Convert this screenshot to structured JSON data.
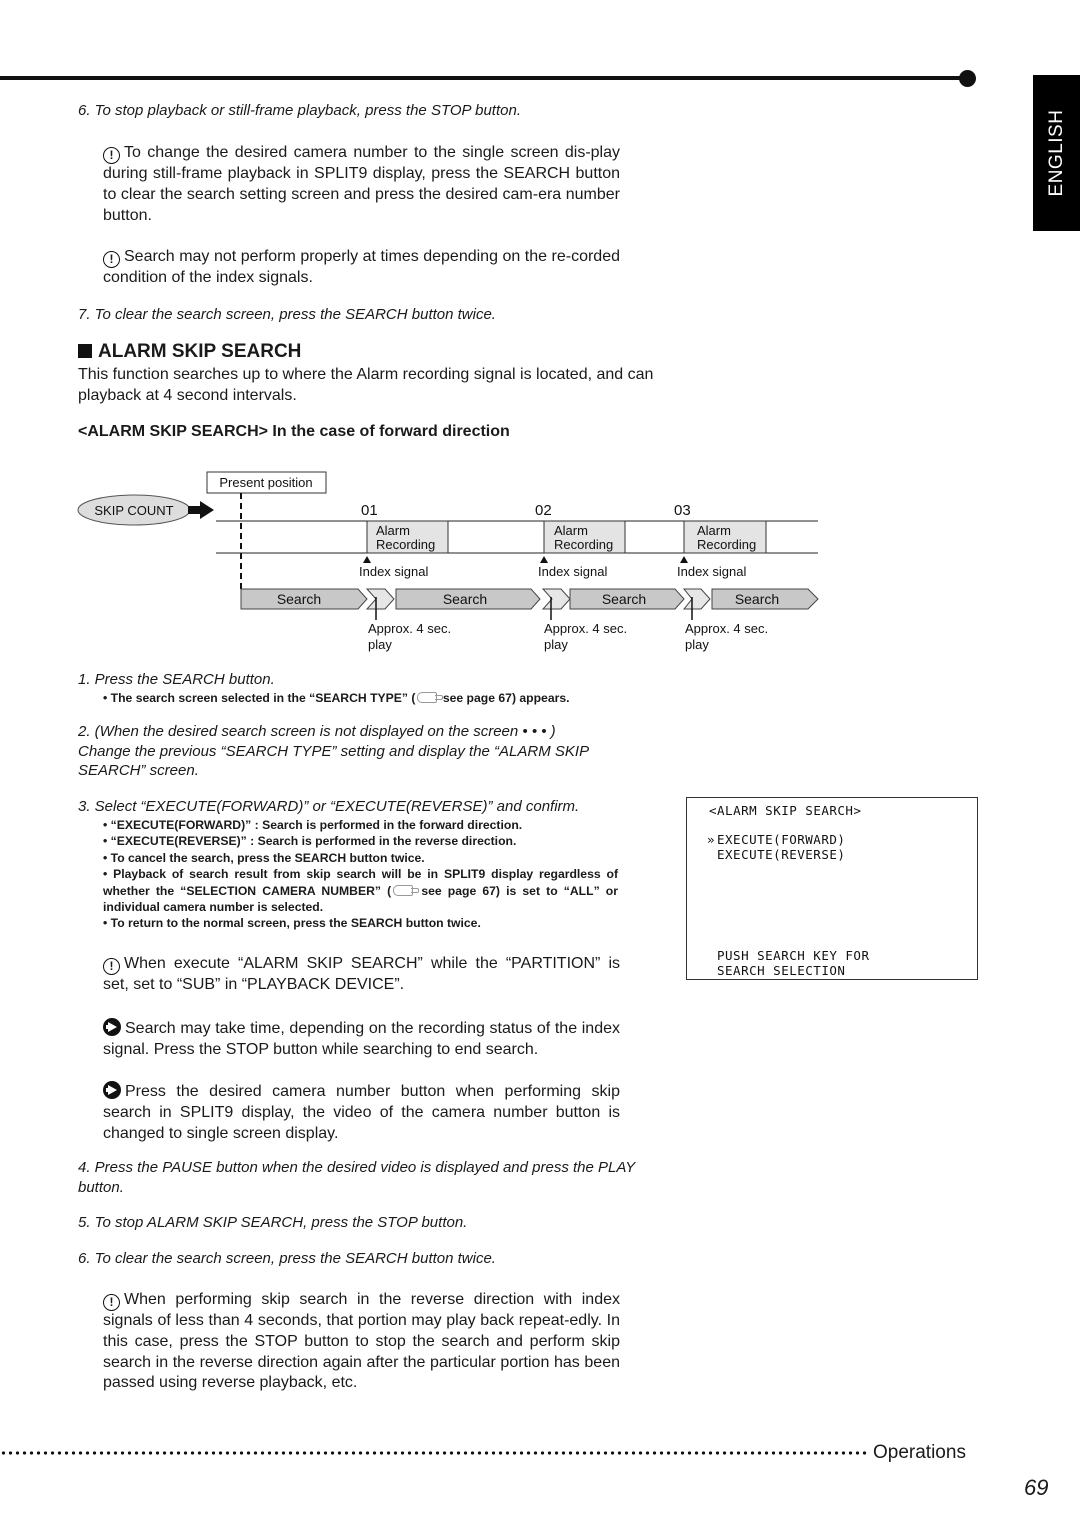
{
  "sidebar_tab": {
    "label": "ENGLISH"
  },
  "top_steps": [
    {
      "text": "6. To stop playback or still-frame playback, press the STOP button."
    },
    {
      "text": "7. To clear the search screen, press the SEARCH button twice."
    }
  ],
  "top_notes": [
    {
      "icon": "caution-icon",
      "text": "To change the desired camera number to the single screen dis-play during still-frame playback in SPLIT9 display, press the SEARCH button to clear the search setting screen and press the desired cam-era number button."
    },
    {
      "icon": "caution-icon",
      "text": "Search may not perform properly at times depending on the re-corded condition of the index signals."
    }
  ],
  "section": {
    "title": "ALARM SKIP SEARCH",
    "intro": "This function searches up to where the Alarm recording signal is located, and can playback at 4 second intervals.",
    "subheading": "<ALARM SKIP SEARCH> In the case of forward direction"
  },
  "diagram": {
    "present_position": "Present position",
    "skip_count": "SKIP COUNT",
    "markers": [
      {
        "count": "01",
        "block_line1": "Alarm",
        "block_line2": "Recording",
        "index_label": "Index signal",
        "play_line1": "Approx. 4 sec.",
        "play_line2": "play"
      },
      {
        "count": "02",
        "block_line1": "Alarm",
        "block_line2": "Recording",
        "index_label": "Index signal",
        "play_line1": "Approx. 4 sec.",
        "play_line2": "play"
      },
      {
        "count": "03",
        "block_line1": "Alarm",
        "block_line2": "Recording",
        "index_label": "Index signal",
        "play_line1": "Approx. 4 sec.",
        "play_line2": "play"
      }
    ],
    "search_labels": [
      "Search",
      "Search",
      "Search",
      "Search"
    ]
  },
  "steps": {
    "s1": "1. Press the SEARCH button.",
    "s1_bullet_pre": "• The search screen selected in the “SEARCH TYPE” (",
    "s1_bullet_post": " see page 67) appears.",
    "s2_line1": "2. (When the desired search screen is not displayed on the screen • • • )",
    "s2_line2": "Change the previous “SEARCH TYPE” setting and display the “ALARM SKIP SEARCH” screen.",
    "s3": "3. Select “EXECUTE(FORWARD)” or “EXECUTE(REVERSE)” and confirm.",
    "s3_bullets": [
      "• “EXECUTE(FORWARD)” : Search is performed in the forward direction.",
      "• “EXECUTE(REVERSE)” : Search is performed in the reverse direction.",
      "• To cancel the search, press the SEARCH button twice."
    ],
    "s3_bullet4_pre": "• Playback of search result from skip search will be in SPLIT9 display regardless of whether the “SELECTION CAMERA NUMBER” (",
    "s3_bullet4_post": " see page 67) is set to “ALL” or individual camera number is selected.",
    "s3_bullet5": "• To return to the normal screen, press the SEARCH button twice.",
    "s4": "4. Press the PAUSE button when the desired video is displayed and press the PLAY button.",
    "s5": "5. To stop ALARM SKIP SEARCH, press the STOP button.",
    "s6": "6. To clear the search screen, press the SEARCH button twice."
  },
  "mid_notes": [
    {
      "icon": "caution-icon",
      "text": "When execute “ALARM SKIP SEARCH” while the “PARTITION” is set, set to “SUB” in “PLAYBACK DEVICE”."
    },
    {
      "icon": "arrow-icon",
      "text": "Search may take time, depending on the recording status of the index signal. Press the STOP button while searching to end search."
    },
    {
      "icon": "arrow-icon",
      "text": "Press the desired camera number button when performing skip search in SPLIT9 display, the video of the camera number button is changed to single screen display."
    }
  ],
  "bottom_note": {
    "icon": "caution-icon",
    "text": "When performing skip search in the reverse direction with index signals of less than 4 seconds, that portion may play back repeat-edly. In this case, press the STOP button to stop the search and perform skip search in the reverse direction again after the particular portion has been passed using reverse playback, etc."
  },
  "osd_screen": {
    "title": "<ALARM SKIP SEARCH>",
    "cursor": "»",
    "options": [
      "EXECUTE(FORWARD)",
      "EXECUTE(REVERSE)"
    ],
    "footer_line1": "PUSH SEARCH KEY FOR",
    "footer_line2": "SEARCH SELECTION"
  },
  "footer": {
    "section": "Operations",
    "page": "69"
  }
}
